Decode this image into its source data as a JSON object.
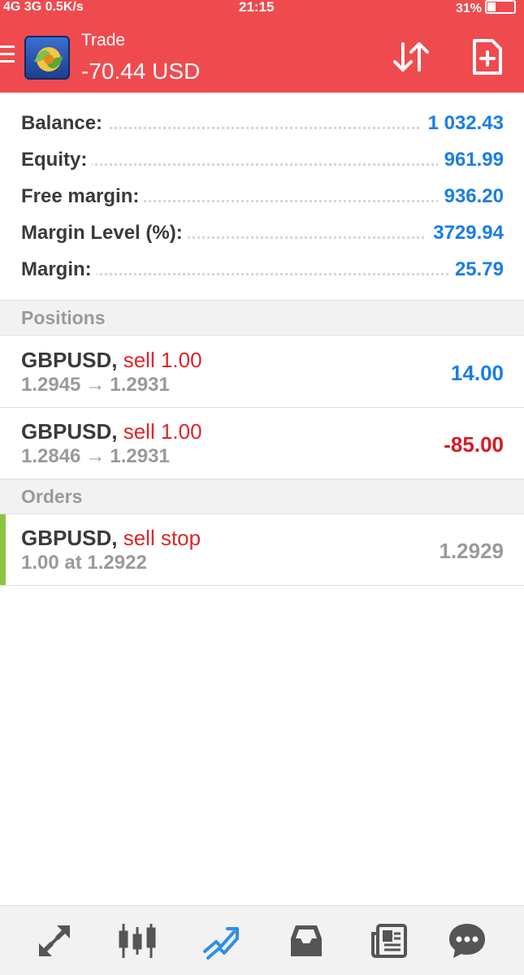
{
  "status_bar": {
    "left": "4G 3G 0.5K/s",
    "time": "21:15",
    "battery": "31%"
  },
  "app_bar": {
    "title": "Trade",
    "profit": "-70.44 USD",
    "icons": [
      "menu-icon",
      "metatrader-logo",
      "sort-icon",
      "new-order-icon"
    ]
  },
  "summary": [
    {
      "label": "Balance:",
      "value": "1 032.43"
    },
    {
      "label": "Equity:",
      "value": "961.99"
    },
    {
      "label": "Free margin:",
      "value": "936.20"
    },
    {
      "label": "Margin Level (%):",
      "value": "3729.94"
    },
    {
      "label": "Margin:",
      "value": "25.79"
    }
  ],
  "positions_header": "Positions",
  "positions": [
    {
      "symbol": "GBPUSD,",
      "type": "sell 1.00",
      "open": "1.2945",
      "arrow": "→",
      "current": "1.2931",
      "profit": "14.00"
    },
    {
      "symbol": "GBPUSD,",
      "type": "sell 1.00",
      "open": "1.2846",
      "arrow": "→",
      "current": "1.2931",
      "profit": "-85.00"
    }
  ],
  "orders_header": "Orders",
  "orders": [
    {
      "symbol": "GBPUSD,",
      "type": "sell stop",
      "detail": "1.00 at 1.2922",
      "price": "1.2929"
    }
  ],
  "colors": {
    "header_red": "#ef4b4f",
    "profit_blue": "#1a7de8",
    "loss_red": "#d8191f",
    "order_marker": "#8cc63f"
  },
  "bottom_nav": [
    "quotes-icon",
    "chart-icon",
    "trade-icon",
    "history-icon",
    "news-icon",
    "chat-icon"
  ]
}
